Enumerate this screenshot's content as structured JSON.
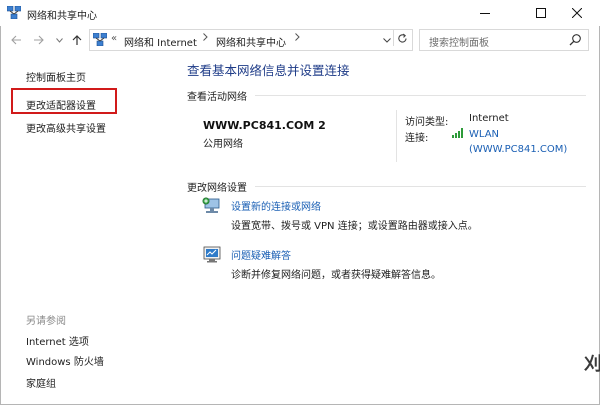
{
  "window": {
    "title": "网络和共享中心"
  },
  "address": {
    "crumb_prefix": "«",
    "crumbs": [
      "网络和 Internet",
      "网络和共享中心"
    ],
    "search_placeholder": "搜索控制面板"
  },
  "left_panel": {
    "home": "控制面板主页",
    "adapter_settings": "更改适配器设置",
    "advanced_sharing": "更改高级共享设置",
    "see_also_title": "另请参阅",
    "see_also": [
      "Internet 选项",
      "Windows 防火墙",
      "家庭组"
    ]
  },
  "main": {
    "heading": "查看基本网络信息并设置连接",
    "active_networks_label": "查看活动网络",
    "network_name": "WWW.PC841.COM  2",
    "network_type": "公用网络",
    "access_type_label": "访问类型:",
    "access_type_value": "Internet",
    "connections_label": "连接:",
    "connection_value": "WLAN",
    "connection_sub": "(WWW.PC841.COM)",
    "change_settings_label": "更改网络设置",
    "tasks": [
      {
        "title": "设置新的连接或网络",
        "desc": "设置宽带、拨号或 VPN 连接；或设置路由器或接入点。",
        "icon": "new-connection-icon"
      },
      {
        "title": "问题疑难解答",
        "desc": "诊断并修复网络问题，或者获得疑难解答信息。",
        "icon": "troubleshoot-icon"
      }
    ]
  },
  "watermark": "刈",
  "colors": {
    "link": "#1a5fb4",
    "heading": "#1f3c88",
    "highlight": "#d11a1a"
  }
}
